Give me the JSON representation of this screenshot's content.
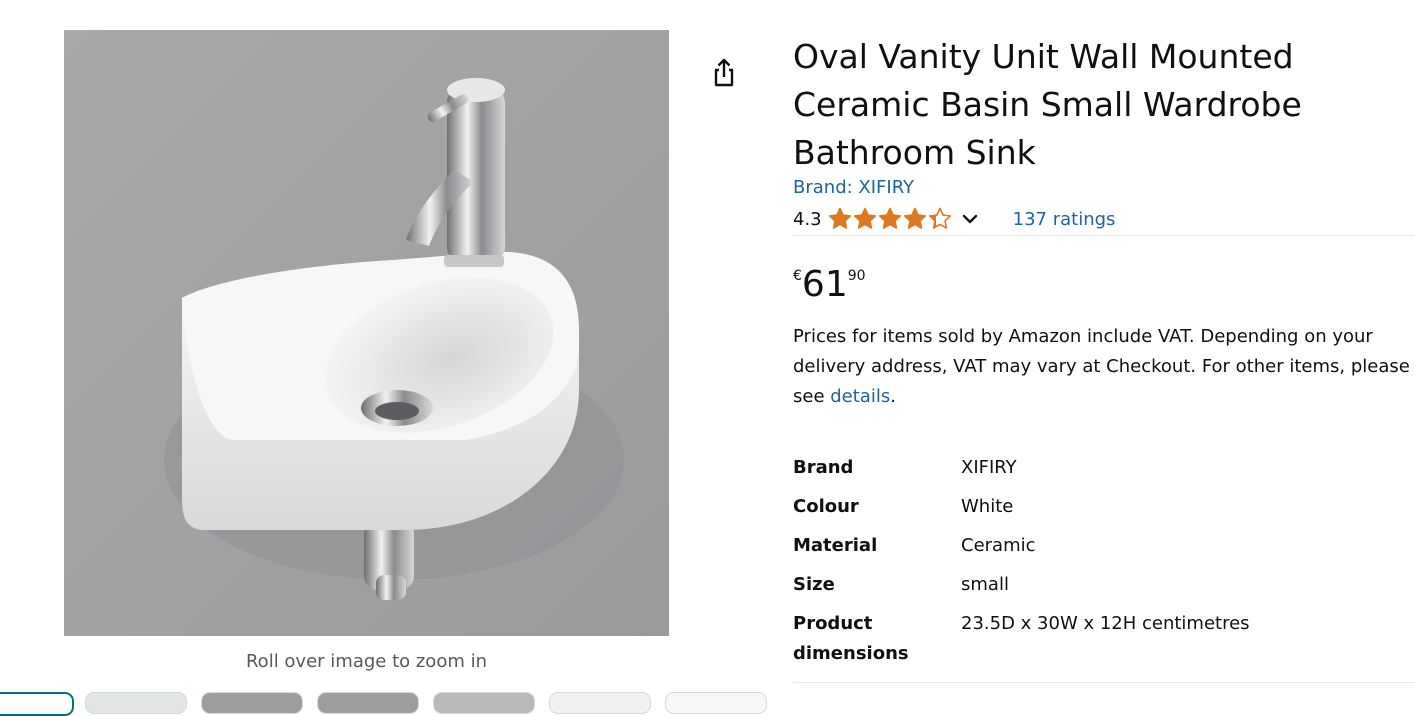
{
  "gallery": {
    "zoom_hint": "Roll over image to zoom in",
    "main_image": "white-ceramic-corner-basin-with-chrome-tap"
  },
  "product": {
    "title": "Oval Vanity Unit Wall Mounted Ceramic Basin Small Wardrobe Bathroom Sink",
    "brand_link": "Brand: XIFIRY",
    "rating": {
      "value": "4.3",
      "stars": 4.3,
      "count_text": "137 ratings"
    },
    "price": {
      "currency": "€",
      "whole": "61",
      "fraction": "90"
    },
    "vat_note": {
      "text": "Prices for items sold by Amazon include VAT. Depending on your delivery address, VAT may vary at Checkout. For other items, please see ",
      "link": "details",
      "end": "."
    },
    "specs": [
      {
        "label": "Brand",
        "value": "XIFIRY"
      },
      {
        "label": "Colour",
        "value": "White"
      },
      {
        "label": "Material",
        "value": "Ceramic"
      },
      {
        "label": "Size",
        "value": "small"
      },
      {
        "label": "Product dimensions",
        "value": "23.5D x 30W x 12H centimetres"
      }
    ]
  },
  "icons": {
    "share": "share-icon",
    "star": "star-icon",
    "chevron": "chevron-down-icon"
  },
  "colors": {
    "link": "#2162a1",
    "star": "#de7921",
    "text": "#0f1111",
    "muted": "#565959",
    "thumb_active_border": "#007185"
  }
}
